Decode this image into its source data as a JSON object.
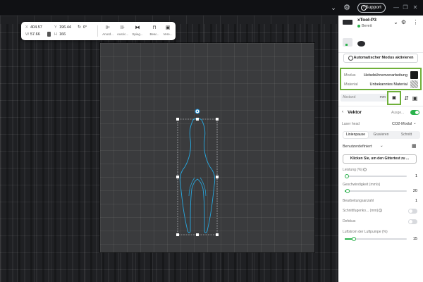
{
  "window": {
    "support_label": "Support",
    "chevron_glyph": "⌄",
    "gear_glyph": "⚙",
    "minimize_glyph": "—",
    "maximize_glyph": "❐",
    "close_glyph": "✕"
  },
  "toolbar": {
    "x_label": "X",
    "x_value": "404.57",
    "y_label": "Y",
    "y_value": "196.44",
    "w_label": "W",
    "w_value": "57.66",
    "h_label": "H",
    "h_value": "166",
    "rotation_value": "0°",
    "tools": [
      {
        "label": "Anord...",
        "icon": "align-icon",
        "glyph": "⊫"
      },
      {
        "label": "Ausric...",
        "icon": "distribute-icon",
        "glyph": "⊪"
      },
      {
        "label": "Spieg...",
        "icon": "mirror-icon",
        "glyph": "⧓"
      },
      {
        "label": "Bear...",
        "icon": "edit-icon",
        "glyph": "⊓"
      },
      {
        "label": "Vere...",
        "icon": "combine-icon",
        "glyph": "▣"
      }
    ]
  },
  "panel": {
    "device_name": "xTool-P3",
    "device_status": "Bereit",
    "status_color": "#2bb24c",
    "auto_button": "Automatischer Modus aktivieren",
    "mode_label": "Modus",
    "mode_value": "Hebebühnenverarbeitung",
    "material_label": "Material",
    "material_value": "Unbekanntes Material",
    "distance_label": "Abstand",
    "distance_unit": "mm",
    "section_title": "Vektor",
    "output_label": "Ausge...",
    "output_enabled": true,
    "laser_head_label": "Laser head",
    "laser_head_value": "CO2-Modul",
    "tabs": [
      {
        "label": "Linienpause",
        "active": true
      },
      {
        "label": "Gravieren",
        "active": false
      },
      {
        "label": "Schnitt",
        "active": false
      }
    ],
    "preset_value": "Benutzerdefiniert",
    "grid_test_button": "Klicken Sie, um den Gittertest zu ...",
    "power_label": "Leistung",
    "power_unit": "(%)",
    "power_value": "1",
    "power_fraction": 0.01,
    "speed_label": "Geschwindigkeit",
    "speed_unit": "(mm/s)",
    "speed_value": "20",
    "speed_fraction": 0.04,
    "passes_label": "Bearbeitungsanzahl",
    "passes_value": "1",
    "kerf_label": "Schnittfugenko...",
    "kerf_unit": "(mm)",
    "defocus_label": "Defokus",
    "defocus_enabled": false,
    "air_label": "Luftstrom der Luftpumpe",
    "air_unit": "(%)",
    "air_value": "15",
    "air_fraction": 0.15,
    "accent_color": "#2bb24c",
    "highlight_color": "#6fb03a"
  }
}
